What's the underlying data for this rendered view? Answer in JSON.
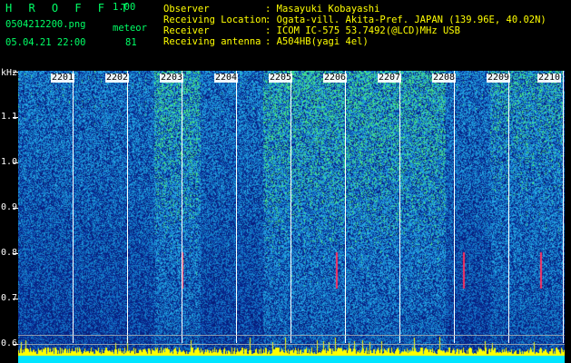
{
  "app": {
    "name": "H R O F F T",
    "version": "1.00",
    "filename": "0504212200.png",
    "datetime": "05.04.21 22:00",
    "meteor_label": "meteor",
    "meteor_count": "81"
  },
  "info": [
    {
      "label": "Observer",
      "value": ": Masayuki Kobayashi"
    },
    {
      "label": "Receiving Location",
      "value": ": Ogata-vill. Akita-Pref. JAPAN (139.96E, 40.02N)"
    },
    {
      "label": "Receiver",
      "value": ": ICOM IC-575 53.7492(@LCD)MHz USB"
    },
    {
      "label": "Receiving antenna",
      "value": ": A504HB(yagi 4el)"
    }
  ],
  "axis": {
    "unit": "kHz",
    "ticks": [
      "1.1",
      "1.0",
      "0.9",
      "0.8",
      "0.7",
      "0.6"
    ]
  },
  "minutes": [
    "2201",
    "2202",
    "2203",
    "2204",
    "2205",
    "2206",
    "2207",
    "2208",
    "2209",
    "2210"
  ],
  "colors": {
    "background": "#000000",
    "header_text": "#ffff00",
    "title_text": "#00ff66",
    "spectrum_low": "#0a1a88",
    "spectrum_mid": "#1a7fe0",
    "spectrum_high": "#3ee08a",
    "echo_bars": "#ffff00",
    "baseline": "#00e5ff"
  }
}
